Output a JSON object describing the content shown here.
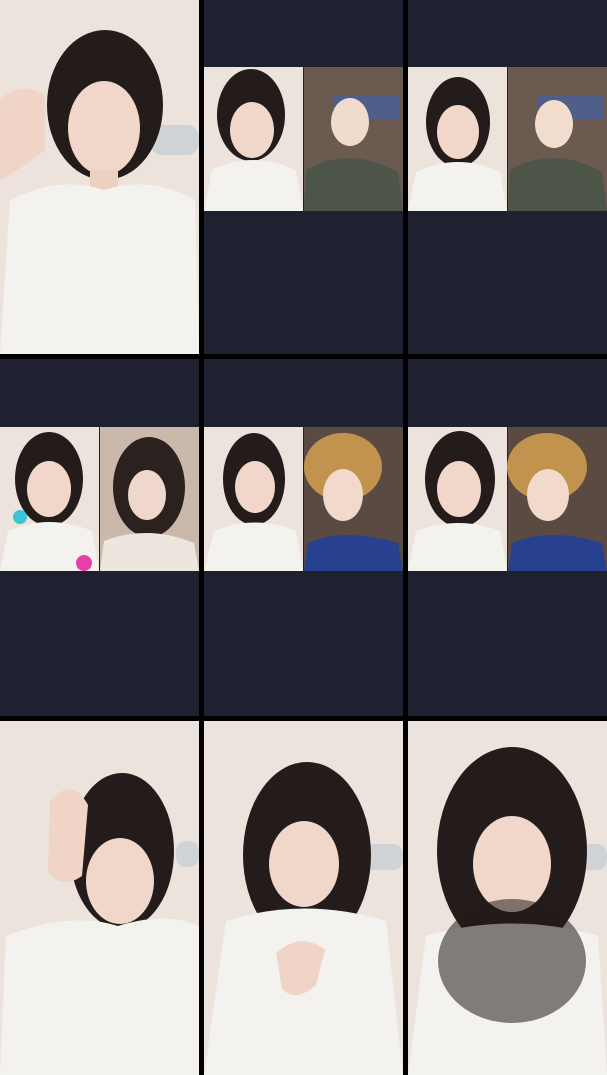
{
  "layout": {
    "rows": 3,
    "cols": 3
  },
  "colors": {
    "empty_panel": "#1f2131",
    "divider": "#000000",
    "wall_light": "#ebe3da",
    "wall_dark": "#5a4a42",
    "shirt_white": "#f3f1ee",
    "shirt_olive": "#4c5548",
    "jacket_blue": "#27418f",
    "hair_black": "#1f1a18",
    "hair_blonde": "#c2924f",
    "skin": "#f1d9cb",
    "accent_pink": "#e83ea7",
    "accent_cyan": "#37c6d7"
  },
  "tiles": [
    {
      "kind": "single",
      "subject": "woman-white-tshirt-hand-raised"
    },
    {
      "kind": "split-call",
      "top_band": true,
      "left": "woman-white-tshirt",
      "right": "man-olive-shirt"
    },
    {
      "kind": "split-call",
      "top_band": true,
      "left": "woman-white-tshirt",
      "right": "man-olive-shirt"
    },
    {
      "kind": "split-call",
      "top_band": true,
      "left": "woman-white-tshirt-pink-effect",
      "right": "woman-long-dark-hair"
    },
    {
      "kind": "split-call",
      "top_band": true,
      "left": "woman-white-tshirt",
      "right": "person-blonde-hair-blue-jacket"
    },
    {
      "kind": "split-call",
      "top_band": true,
      "left": "woman-white-tshirt",
      "right": "person-blonde-hair-blue-jacket"
    },
    {
      "kind": "single",
      "subject": "woman-hand-on-head"
    },
    {
      "kind": "single",
      "subject": "woman-hand-on-chest"
    },
    {
      "kind": "single",
      "subject": "woman-long-hair"
    }
  ]
}
